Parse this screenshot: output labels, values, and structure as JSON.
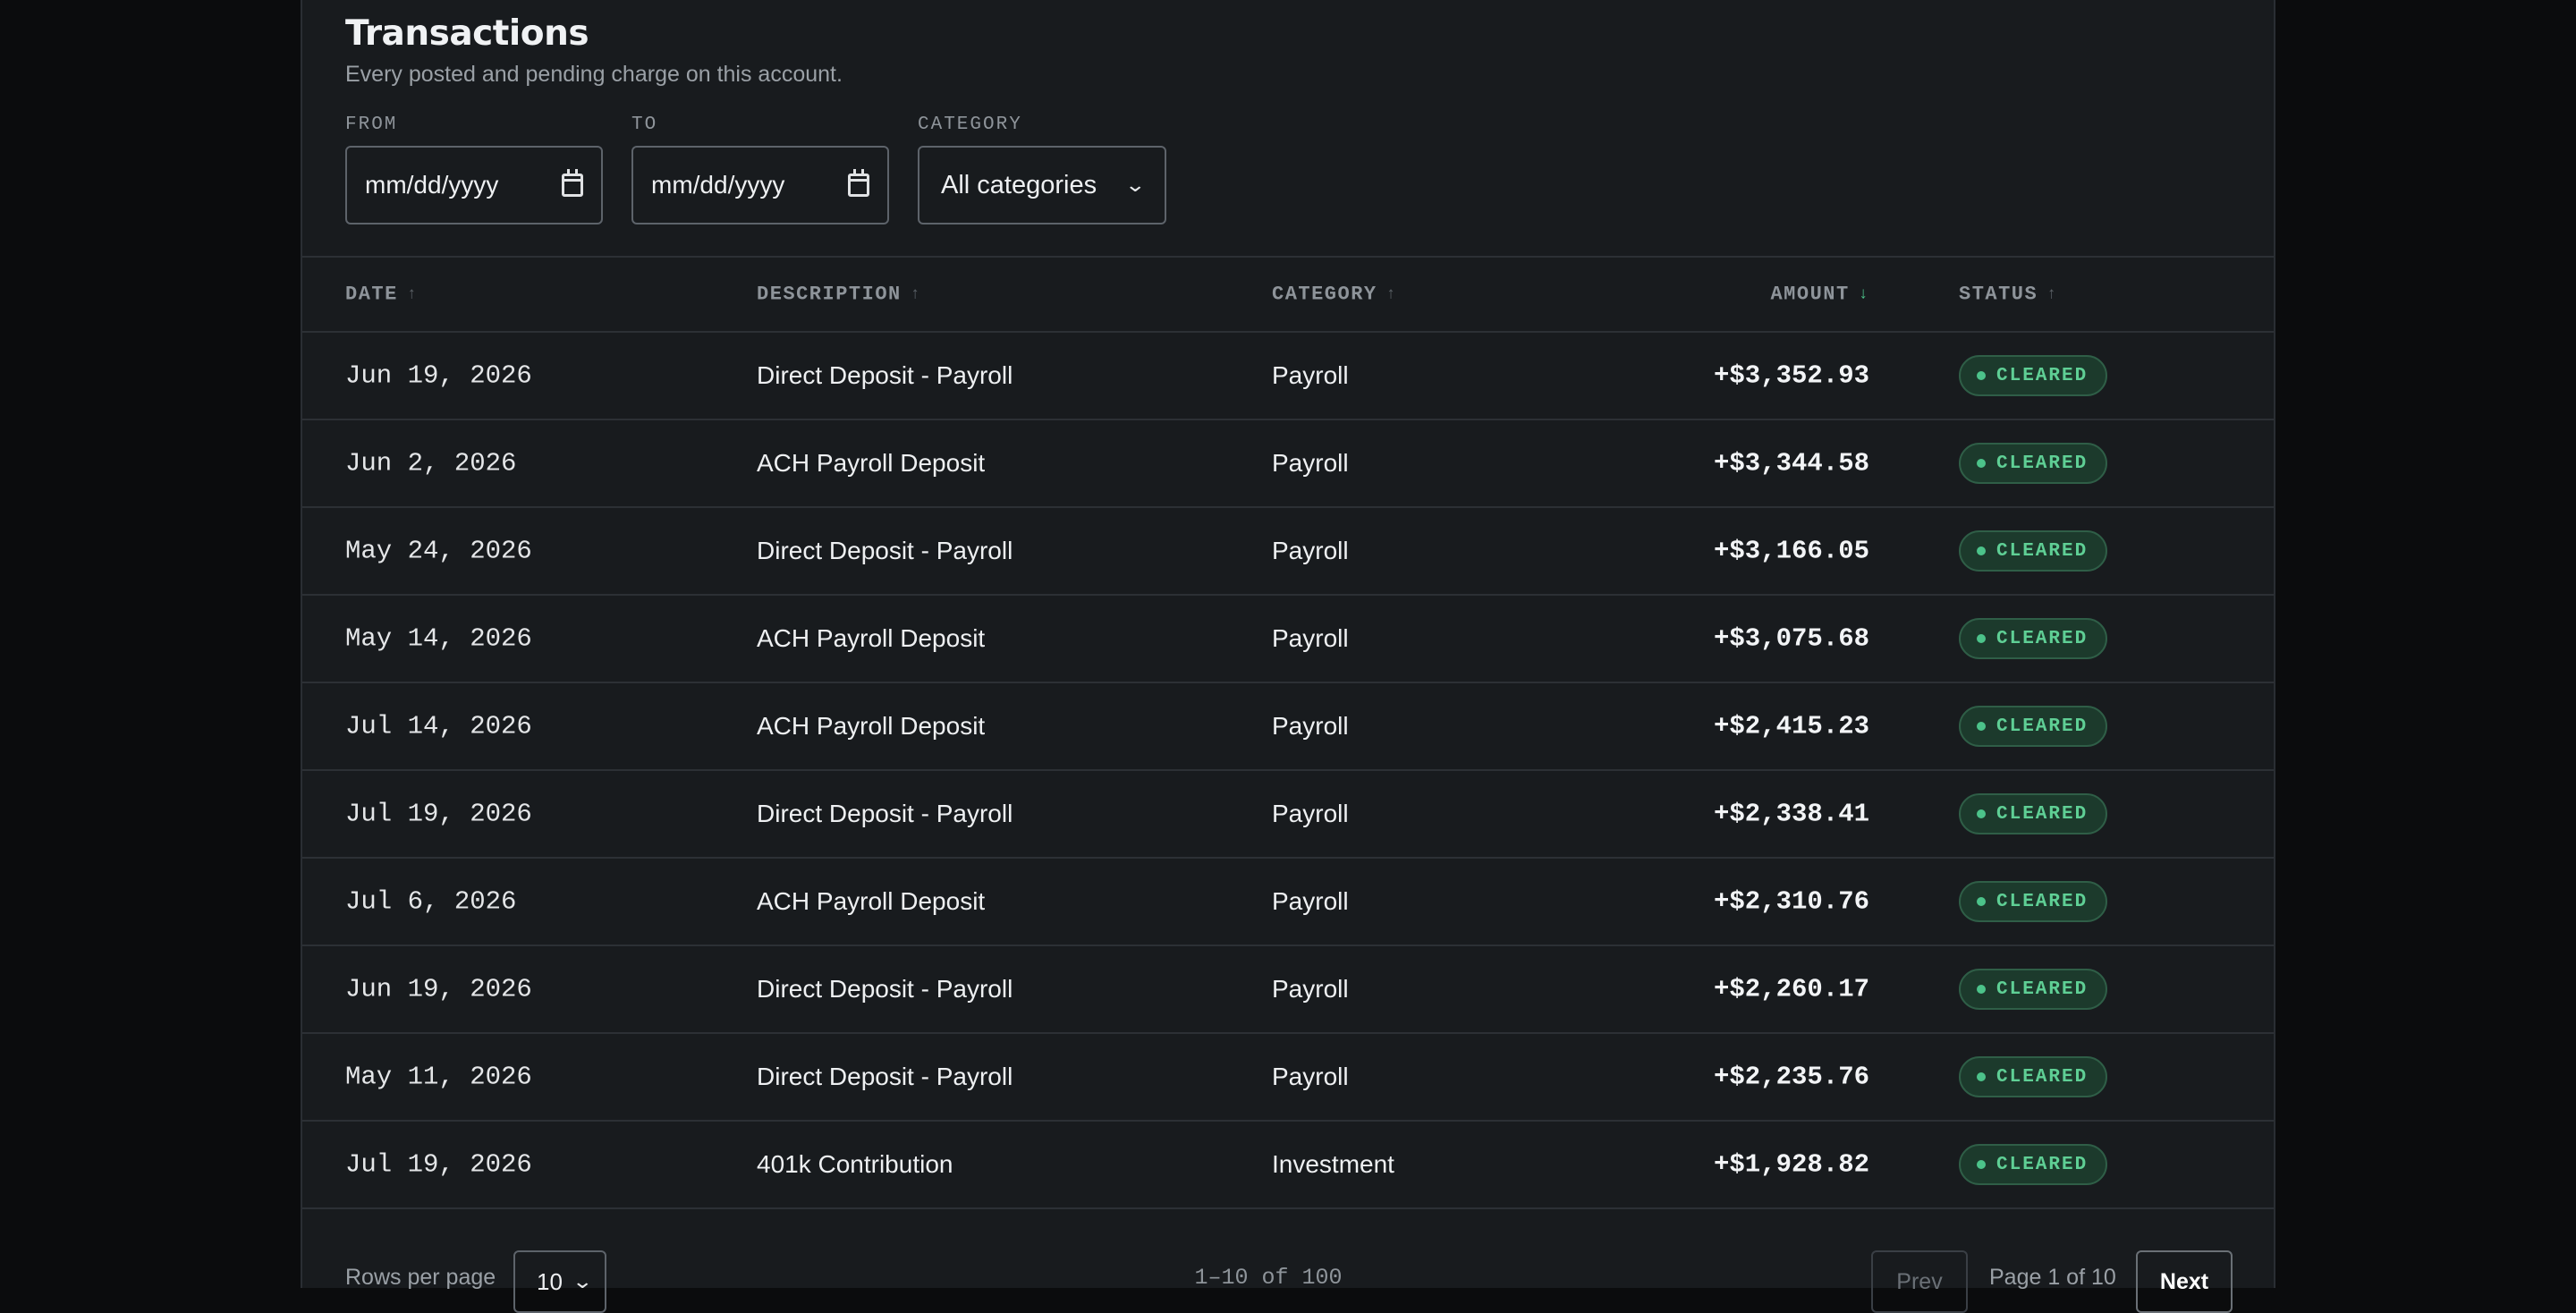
{
  "header": {
    "title": "Transactions",
    "subtitle": "Every posted and pending charge on this account."
  },
  "filters": {
    "from_label": "FROM",
    "from_placeholder": "mm/dd/yyyy",
    "to_label": "TO",
    "to_placeholder": "mm/dd/yyyy",
    "category_label": "CATEGORY",
    "category_value": "All categories"
  },
  "table": {
    "columns": {
      "date": "DATE",
      "description": "DESCRIPTION",
      "category": "CATEGORY",
      "amount": "AMOUNT",
      "status": "STATUS"
    },
    "sort": {
      "column": "amount",
      "direction": "desc"
    },
    "rows": [
      {
        "date": "Jun 19, 2026",
        "description": "Direct Deposit - Payroll",
        "category": "Payroll",
        "amount": "+$3,352.93",
        "status": "CLEARED"
      },
      {
        "date": "Jun 2, 2026",
        "description": "ACH Payroll Deposit",
        "category": "Payroll",
        "amount": "+$3,344.58",
        "status": "CLEARED"
      },
      {
        "date": "May 24, 2026",
        "description": "Direct Deposit - Payroll",
        "category": "Payroll",
        "amount": "+$3,166.05",
        "status": "CLEARED"
      },
      {
        "date": "May 14, 2026",
        "description": "ACH Payroll Deposit",
        "category": "Payroll",
        "amount": "+$3,075.68",
        "status": "CLEARED"
      },
      {
        "date": "Jul 14, 2026",
        "description": "ACH Payroll Deposit",
        "category": "Payroll",
        "amount": "+$2,415.23",
        "status": "CLEARED"
      },
      {
        "date": "Jul 19, 2026",
        "description": "Direct Deposit - Payroll",
        "category": "Payroll",
        "amount": "+$2,338.41",
        "status": "CLEARED"
      },
      {
        "date": "Jul 6, 2026",
        "description": "ACH Payroll Deposit",
        "category": "Payroll",
        "amount": "+$2,310.76",
        "status": "CLEARED"
      },
      {
        "date": "Jun 19, 2026",
        "description": "Direct Deposit - Payroll",
        "category": "Payroll",
        "amount": "+$2,260.17",
        "status": "CLEARED"
      },
      {
        "date": "May 11, 2026",
        "description": "Direct Deposit - Payroll",
        "category": "Payroll",
        "amount": "+$2,235.76",
        "status": "CLEARED"
      },
      {
        "date": "Jul 19, 2026",
        "description": "401k Contribution",
        "category": "Investment",
        "amount": "+$1,928.82",
        "status": "CLEARED"
      }
    ]
  },
  "footer": {
    "rows_per_page_label": "Rows per page",
    "rows_per_page_value": "10",
    "range_text": "1–10 of 100",
    "prev_label": "Prev",
    "page_indicator": "Page 1 of 10",
    "next_label": "Next"
  },
  "colors": {
    "panel_bg": "#181b1e",
    "page_bg": "#0b0c0d",
    "accent_green": "#4cc38a",
    "badge_bg": "#1c3a2c"
  },
  "icons": {
    "calendar": "calendar-icon",
    "chevron": "chevron-down-icon",
    "sort_asc": "sort-up-arrow-icon",
    "sort_desc": "sort-down-arrow-icon"
  }
}
